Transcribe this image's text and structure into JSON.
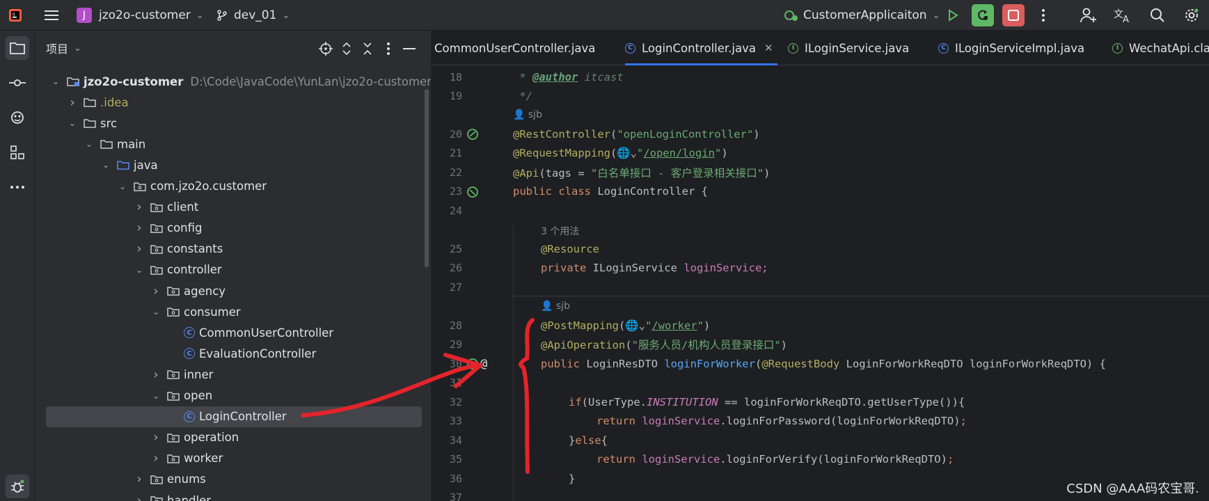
{
  "topbar": {
    "project_badge": "J",
    "project_name": "jzo2o-customer",
    "branch": "dev_01",
    "run_config": "CustomerApplicaiton"
  },
  "project_panel": {
    "title": "项目",
    "tree": [
      {
        "label": "jzo2o-customer",
        "hint": "D:\\Code\\JavaCode\\YunLan\\jzo2o-customer",
        "depth": 0,
        "kind": "module",
        "open": true
      },
      {
        "label": ".idea",
        "depth": 1,
        "kind": "folder",
        "open": false,
        "color": "#b3ae60"
      },
      {
        "label": "src",
        "depth": 1,
        "kind": "folder",
        "open": true
      },
      {
        "label": "main",
        "depth": 2,
        "kind": "folder",
        "open": true
      },
      {
        "label": "java",
        "depth": 3,
        "kind": "folder-blue",
        "open": true
      },
      {
        "label": "com.jzo2o.customer",
        "depth": 4,
        "kind": "package",
        "open": true
      },
      {
        "label": "client",
        "depth": 5,
        "kind": "package",
        "open": false
      },
      {
        "label": "config",
        "depth": 5,
        "kind": "package",
        "open": false
      },
      {
        "label": "constants",
        "depth": 5,
        "kind": "package",
        "open": false
      },
      {
        "label": "controller",
        "depth": 5,
        "kind": "package",
        "open": true
      },
      {
        "label": "agency",
        "depth": 6,
        "kind": "package",
        "open": false
      },
      {
        "label": "consumer",
        "depth": 6,
        "kind": "package",
        "open": true
      },
      {
        "label": "CommonUserController",
        "depth": 7,
        "kind": "class"
      },
      {
        "label": "EvaluationController",
        "depth": 7,
        "kind": "class"
      },
      {
        "label": "inner",
        "depth": 6,
        "kind": "package",
        "open": false
      },
      {
        "label": "open",
        "depth": 6,
        "kind": "package",
        "open": true
      },
      {
        "label": "LoginController",
        "depth": 7,
        "kind": "class",
        "selected": true
      },
      {
        "label": "operation",
        "depth": 6,
        "kind": "package",
        "open": false
      },
      {
        "label": "worker",
        "depth": 6,
        "kind": "package",
        "open": false
      },
      {
        "label": "enums",
        "depth": 5,
        "kind": "package",
        "open": false
      },
      {
        "label": "handler",
        "depth": 5,
        "kind": "package",
        "open": false
      }
    ]
  },
  "tabs": [
    {
      "label": "CommonUserController.java",
      "kind": "class"
    },
    {
      "label": "LoginController.java",
      "kind": "class",
      "active": true
    },
    {
      "label": "ILoginService.java",
      "kind": "interface"
    },
    {
      "label": "ILoginServiceImpl.java",
      "kind": "class"
    },
    {
      "label": "WechatApi.clas",
      "kind": "interface"
    }
  ],
  "code": {
    "hint_author": "sjb",
    "hint_usages": "3 个用法",
    "lines": [
      {
        "n": "18"
      },
      {
        "n": "19"
      },
      {
        "n": "20"
      },
      {
        "n": "21"
      },
      {
        "n": "22"
      },
      {
        "n": "23"
      },
      {
        "n": "24"
      },
      {
        "n": "25"
      },
      {
        "n": "26"
      },
      {
        "n": "27"
      },
      {
        "n": "28"
      },
      {
        "n": "29"
      },
      {
        "n": "30"
      },
      {
        "n": "31"
      },
      {
        "n": "32"
      },
      {
        "n": "33"
      },
      {
        "n": "34"
      },
      {
        "n": "35"
      },
      {
        "n": "36"
      },
      {
        "n": "37"
      }
    ],
    "author_tag": "@author",
    "author_name": " itcast",
    "doc_end": " */",
    "ann_rest": "@RestController",
    "str_rest": "\"openLoginController\"",
    "ann_req": "@RequestMapping",
    "str_req_path": "/open/login",
    "ann_api": "@Api",
    "api_tags": "(tags = ",
    "str_api": "\"白名单接口 - 客户登录相关接口\"",
    "kw_public_class": "public class ",
    "class_name": "LoginController {",
    "ann_resource": "@Resource",
    "kw_private": "private ",
    "type_service": "ILoginService ",
    "field_service": "loginService;",
    "ann_post": "@PostMapping",
    "str_post_path": "/worker",
    "ann_apiop": "@ApiOperation",
    "str_apiop": "\"服务人员/机构人员登录接口\"",
    "kw_public": "public ",
    "type_res": "LoginResDTO ",
    "method_name": "loginForWorker",
    "ann_body": "@RequestBody",
    "params": " LoginForWorkReqDTO loginForWorkReqDTO) {",
    "kw_if": "if",
    "if_a": "(UserType.",
    "static_inst": "INSTITUTION",
    "if_b": " == loginForWorkReqDTO.getUserType()){",
    "kw_return": "return ",
    "ret1_call": ".loginForPassword(loginForWorkReqDTO)",
    "kw_else": "else",
    "ret2_call": ".loginForVerify(loginForWorkReqDTO)",
    "field_ref": "loginService",
    "semicolon": ";"
  },
  "watermark": "CSDN @AAA码农宝哥."
}
